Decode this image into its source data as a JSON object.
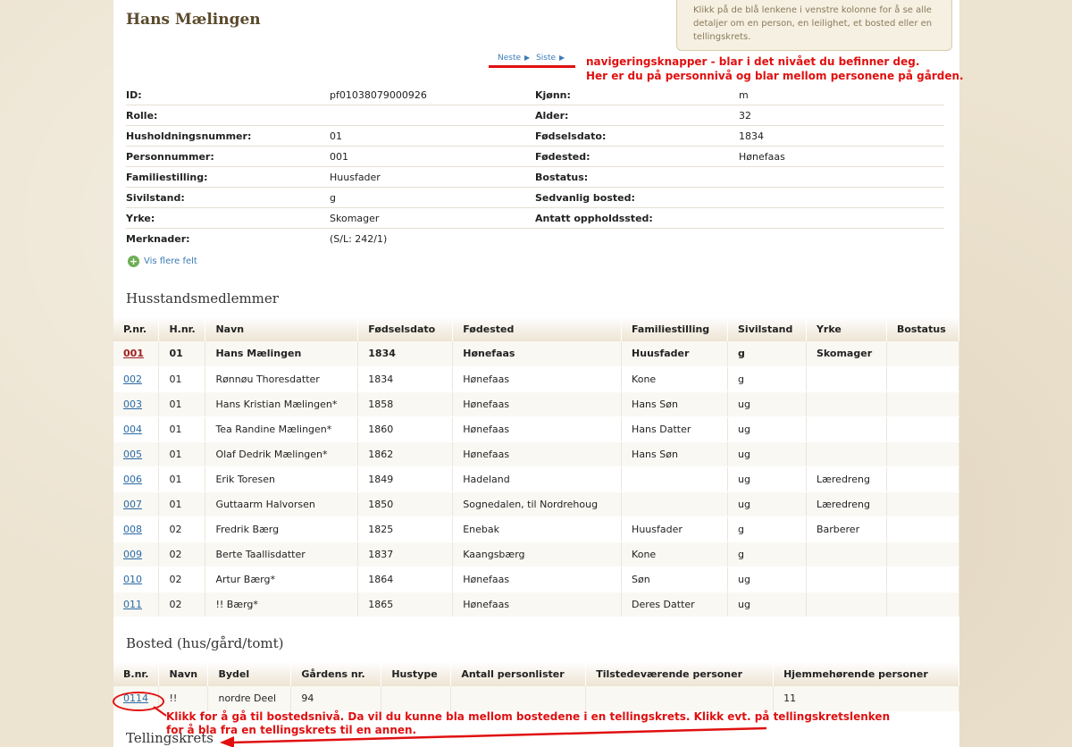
{
  "title": "Hans Mælingen",
  "info_text": "Klikk på de blå lenkene i venstre kolonne for å se alle detaljer om en person, en leilighet, et bosted eller en tellingskrets.",
  "nav": {
    "next": "Neste",
    "last": "Siste"
  },
  "details": [
    {
      "label": "ID:",
      "value": "pf01038079000926",
      "label2": "Kjønn:",
      "value2": "m"
    },
    {
      "label": "Rolle:",
      "value": "",
      "label2": "Alder:",
      "value2": "32"
    },
    {
      "label": "Husholdningsnummer:",
      "value": "01",
      "label2": "Fødselsdato:",
      "value2": "1834"
    },
    {
      "label": "Personnummer:",
      "value": "001",
      "label2": "Fødested:",
      "value2": "Hønefaas"
    },
    {
      "label": "Familiestilling:",
      "value": "Huusfader",
      "label2": "Bostatus:",
      "value2": ""
    },
    {
      "label": "Sivilstand:",
      "value": "g",
      "label2": "Sedvanlig bosted:",
      "value2": ""
    },
    {
      "label": "Yrke:",
      "value": "Skomager",
      "label2": "Antatt oppholdssted:",
      "value2": ""
    },
    {
      "label": "Merknader:",
      "value": "(S/L: 242/1)",
      "label2": "",
      "value2": ""
    }
  ],
  "more_fields": "Vis flere felt",
  "household": {
    "heading": "Husstandsmedlemmer",
    "columns": [
      "P.nr.",
      "H.nr.",
      "Navn",
      "Fødselsdato",
      "Fødested",
      "Familiestilling",
      "Sivilstand",
      "Yrke",
      "Bostatus"
    ],
    "rows": [
      [
        "001",
        "01",
        "Hans Mælingen",
        "1834",
        "Hønefaas",
        "Huusfader",
        "g",
        "Skomager",
        ""
      ],
      [
        "002",
        "01",
        "Rønnøu Thoresdatter",
        "1834",
        "Hønefaas",
        "Kone",
        "g",
        "",
        ""
      ],
      [
        "003",
        "01",
        "Hans Kristian Mælingen*",
        "1858",
        "Hønefaas",
        "Hans Søn",
        "ug",
        "",
        ""
      ],
      [
        "004",
        "01",
        "Tea Randine Mælingen*",
        "1860",
        "Hønefaas",
        "Hans Datter",
        "ug",
        "",
        ""
      ],
      [
        "005",
        "01",
        "Olaf Dedrik Mælingen*",
        "1862",
        "Hønefaas",
        "Hans Søn",
        "ug",
        "",
        ""
      ],
      [
        "006",
        "01",
        "Erik Toresen",
        "1849",
        "Hadeland",
        "",
        "ug",
        "Læredreng",
        ""
      ],
      [
        "007",
        "01",
        "Guttaarm Halvorsen",
        "1850",
        "Sognedalen, til Nordrehoug",
        "",
        "ug",
        "Læredreng",
        ""
      ],
      [
        "008",
        "02",
        "Fredrik Bærg",
        "1825",
        "Enebak",
        "Huusfader",
        "g",
        "Barberer",
        ""
      ],
      [
        "009",
        "02",
        "Berte Taallisdatter",
        "1837",
        "Kaangsbærg",
        "Kone",
        "g",
        "",
        ""
      ],
      [
        "010",
        "02",
        "Artur Bærg*",
        "1864",
        "Hønefaas",
        "Søn",
        "ug",
        "",
        ""
      ],
      [
        "011",
        "02",
        "!! Bærg*",
        "1865",
        "Hønefaas",
        "Deres Datter",
        "ug",
        "",
        ""
      ]
    ]
  },
  "residence": {
    "heading": "Bosted (hus/gård/tomt)",
    "columns": [
      "B.nr.",
      "Navn",
      "Bydel",
      "Gårdens nr.",
      "Hustype",
      "Antall personlister",
      "Tilstedeværende personer",
      "Hjemmehørende personer"
    ],
    "rows": [
      [
        "0114",
        "!!",
        "nordre Deel",
        "94",
        "",
        "",
        "",
        "11"
      ]
    ]
  },
  "census_heading": "Tellingskrets",
  "annotations": {
    "nav_note_1": "navigeringsknapper - blar i det nivået du befinner deg.",
    "nav_note_2": "Her er du på personnivå og blar mellom personene på gården.",
    "bosted_note_1": "Klikk for å gå til bostedsnivå. Da vil du kunne bla mellom bostedene i en tellingskrets. Klikk evt. på tellingskretslenken",
    "bosted_note_2": "for å bla fra en tellingskrets til en annen."
  },
  "colors": {
    "link": "#2a6aa6",
    "annotation": "#e01010",
    "title": "#5b4a2c"
  }
}
